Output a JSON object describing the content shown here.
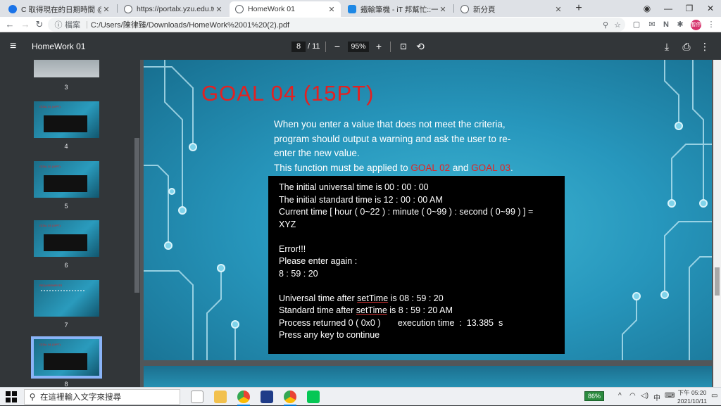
{
  "browser": {
    "tabs": [
      {
        "label": "C 取得現在的日期時間 @ 數位生",
        "icon_color": "#1a73e8"
      },
      {
        "label": "https://portalx.yzu.edu.tw/Porta",
        "icon_color": "#5f6368"
      },
      {
        "label": "HomeWork 01",
        "icon_color": "#5f6368"
      },
      {
        "label": "鐵輸筆機 - iT 邦幫忙::一起幫忙解",
        "icon_color": "#1e88e5"
      },
      {
        "label": "新分頁",
        "icon_color": "#5f6368"
      }
    ],
    "new_tab_label": "+",
    "address": {
      "protocol_label": "檔案",
      "url": "C:/Users/陳律臻/Downloads/HomeWork%2001%20(2).pdf"
    },
    "profile_label": "暫停"
  },
  "pdf_toolbar": {
    "title": "HomeWork 01",
    "current_page": "8",
    "total_pages": "/ 11",
    "zoom": "95%",
    "zoom_out": "−",
    "zoom_in": "+"
  },
  "sidebar": {
    "thumbnails": [
      {
        "num": "3",
        "title": "",
        "kind": "top"
      },
      {
        "num": "4",
        "title": "GOAL 01 (10PT)",
        "kind": "console"
      },
      {
        "num": "5",
        "title": "GOAL 02 (15PT)",
        "kind": "console"
      },
      {
        "num": "6",
        "title": "GOAL 03 (15PT)",
        "kind": "console"
      },
      {
        "num": "7",
        "title": "REQUIREMENTS",
        "kind": "list"
      },
      {
        "num": "8",
        "title": "GOAL 04 (15PT)",
        "kind": "console",
        "selected": true
      }
    ]
  },
  "slide": {
    "title": "GOAL 04 (15PT)",
    "desc_line1": "When you enter a value that does not meet the criteria,",
    "desc_line2": "program should output a warning and ask the user to re-",
    "desc_line3": "enter the new value.",
    "desc_line4_prefix": "This function must be applied to ",
    "desc_goal02": "GOAL 02",
    "desc_and": " and ",
    "desc_goal03": "GOAL 03",
    "desc_end": ".",
    "console": {
      "l1": "The initial universal time is 00 : 00 : 00",
      "l2": "The initial standard time is 12 : 00 : 00 AM",
      "l3": "Current time [ hour ( 0~22 ) : minute ( 0~99 ) : second ( 0~99 ) ] =",
      "l4": "XYZ",
      "l5": "Error!!!",
      "l6": "Please enter again :",
      "l7": "8 : 59 : 20",
      "l8a": "Universal time after ",
      "l8b": "setTime",
      "l8c": " is 08 : 59 : 20",
      "l9a": "Standard time after ",
      "l9b": "setTime",
      "l9c": " is 8 : 59 : 20 AM",
      "l10": "Process returned 0 ( 0x0 )       execution time  :  13.385  s",
      "l11": "Press any key to continue"
    }
  },
  "taskbar": {
    "search_placeholder": "在這裡輸入文字來搜尋",
    "battery": "86%",
    "ime": "中",
    "time": "下午 05:20",
    "date": "2021/10/11"
  },
  "colors": {
    "goal_red": "#e32121",
    "slide_blue": "#2797bd",
    "pdf_toolbar": "#323639"
  }
}
